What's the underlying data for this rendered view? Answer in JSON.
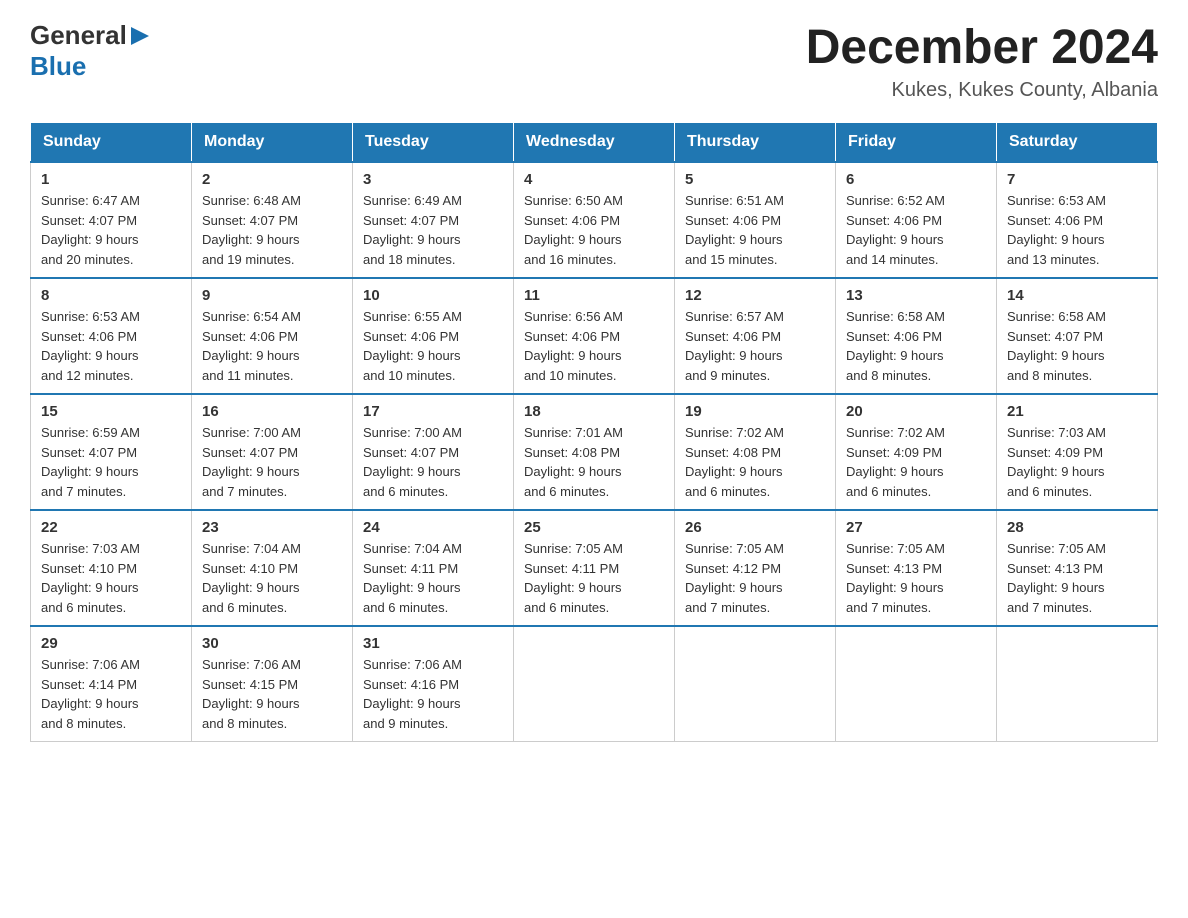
{
  "header": {
    "logo_general": "General",
    "logo_blue": "Blue",
    "title": "December 2024",
    "subtitle": "Kukes, Kukes County, Albania"
  },
  "weekdays": [
    "Sunday",
    "Monday",
    "Tuesday",
    "Wednesday",
    "Thursday",
    "Friday",
    "Saturday"
  ],
  "weeks": [
    [
      {
        "day": "1",
        "sunrise": "6:47 AM",
        "sunset": "4:07 PM",
        "daylight": "9 hours and 20 minutes."
      },
      {
        "day": "2",
        "sunrise": "6:48 AM",
        "sunset": "4:07 PM",
        "daylight": "9 hours and 19 minutes."
      },
      {
        "day": "3",
        "sunrise": "6:49 AM",
        "sunset": "4:07 PM",
        "daylight": "9 hours and 18 minutes."
      },
      {
        "day": "4",
        "sunrise": "6:50 AM",
        "sunset": "4:06 PM",
        "daylight": "9 hours and 16 minutes."
      },
      {
        "day": "5",
        "sunrise": "6:51 AM",
        "sunset": "4:06 PM",
        "daylight": "9 hours and 15 minutes."
      },
      {
        "day": "6",
        "sunrise": "6:52 AM",
        "sunset": "4:06 PM",
        "daylight": "9 hours and 14 minutes."
      },
      {
        "day": "7",
        "sunrise": "6:53 AM",
        "sunset": "4:06 PM",
        "daylight": "9 hours and 13 minutes."
      }
    ],
    [
      {
        "day": "8",
        "sunrise": "6:53 AM",
        "sunset": "4:06 PM",
        "daylight": "9 hours and 12 minutes."
      },
      {
        "day": "9",
        "sunrise": "6:54 AM",
        "sunset": "4:06 PM",
        "daylight": "9 hours and 11 minutes."
      },
      {
        "day": "10",
        "sunrise": "6:55 AM",
        "sunset": "4:06 PM",
        "daylight": "9 hours and 10 minutes."
      },
      {
        "day": "11",
        "sunrise": "6:56 AM",
        "sunset": "4:06 PM",
        "daylight": "9 hours and 10 minutes."
      },
      {
        "day": "12",
        "sunrise": "6:57 AM",
        "sunset": "4:06 PM",
        "daylight": "9 hours and 9 minutes."
      },
      {
        "day": "13",
        "sunrise": "6:58 AM",
        "sunset": "4:06 PM",
        "daylight": "9 hours and 8 minutes."
      },
      {
        "day": "14",
        "sunrise": "6:58 AM",
        "sunset": "4:07 PM",
        "daylight": "9 hours and 8 minutes."
      }
    ],
    [
      {
        "day": "15",
        "sunrise": "6:59 AM",
        "sunset": "4:07 PM",
        "daylight": "9 hours and 7 minutes."
      },
      {
        "day": "16",
        "sunrise": "7:00 AM",
        "sunset": "4:07 PM",
        "daylight": "9 hours and 7 minutes."
      },
      {
        "day": "17",
        "sunrise": "7:00 AM",
        "sunset": "4:07 PM",
        "daylight": "9 hours and 6 minutes."
      },
      {
        "day": "18",
        "sunrise": "7:01 AM",
        "sunset": "4:08 PM",
        "daylight": "9 hours and 6 minutes."
      },
      {
        "day": "19",
        "sunrise": "7:02 AM",
        "sunset": "4:08 PM",
        "daylight": "9 hours and 6 minutes."
      },
      {
        "day": "20",
        "sunrise": "7:02 AM",
        "sunset": "4:09 PM",
        "daylight": "9 hours and 6 minutes."
      },
      {
        "day": "21",
        "sunrise": "7:03 AM",
        "sunset": "4:09 PM",
        "daylight": "9 hours and 6 minutes."
      }
    ],
    [
      {
        "day": "22",
        "sunrise": "7:03 AM",
        "sunset": "4:10 PM",
        "daylight": "9 hours and 6 minutes."
      },
      {
        "day": "23",
        "sunrise": "7:04 AM",
        "sunset": "4:10 PM",
        "daylight": "9 hours and 6 minutes."
      },
      {
        "day": "24",
        "sunrise": "7:04 AM",
        "sunset": "4:11 PM",
        "daylight": "9 hours and 6 minutes."
      },
      {
        "day": "25",
        "sunrise": "7:05 AM",
        "sunset": "4:11 PM",
        "daylight": "9 hours and 6 minutes."
      },
      {
        "day": "26",
        "sunrise": "7:05 AM",
        "sunset": "4:12 PM",
        "daylight": "9 hours and 7 minutes."
      },
      {
        "day": "27",
        "sunrise": "7:05 AM",
        "sunset": "4:13 PM",
        "daylight": "9 hours and 7 minutes."
      },
      {
        "day": "28",
        "sunrise": "7:05 AM",
        "sunset": "4:13 PM",
        "daylight": "9 hours and 7 minutes."
      }
    ],
    [
      {
        "day": "29",
        "sunrise": "7:06 AM",
        "sunset": "4:14 PM",
        "daylight": "9 hours and 8 minutes."
      },
      {
        "day": "30",
        "sunrise": "7:06 AM",
        "sunset": "4:15 PM",
        "daylight": "9 hours and 8 minutes."
      },
      {
        "day": "31",
        "sunrise": "7:06 AM",
        "sunset": "4:16 PM",
        "daylight": "9 hours and 9 minutes."
      },
      null,
      null,
      null,
      null
    ]
  ],
  "labels": {
    "sunrise": "Sunrise:",
    "sunset": "Sunset:",
    "daylight": "Daylight:"
  }
}
